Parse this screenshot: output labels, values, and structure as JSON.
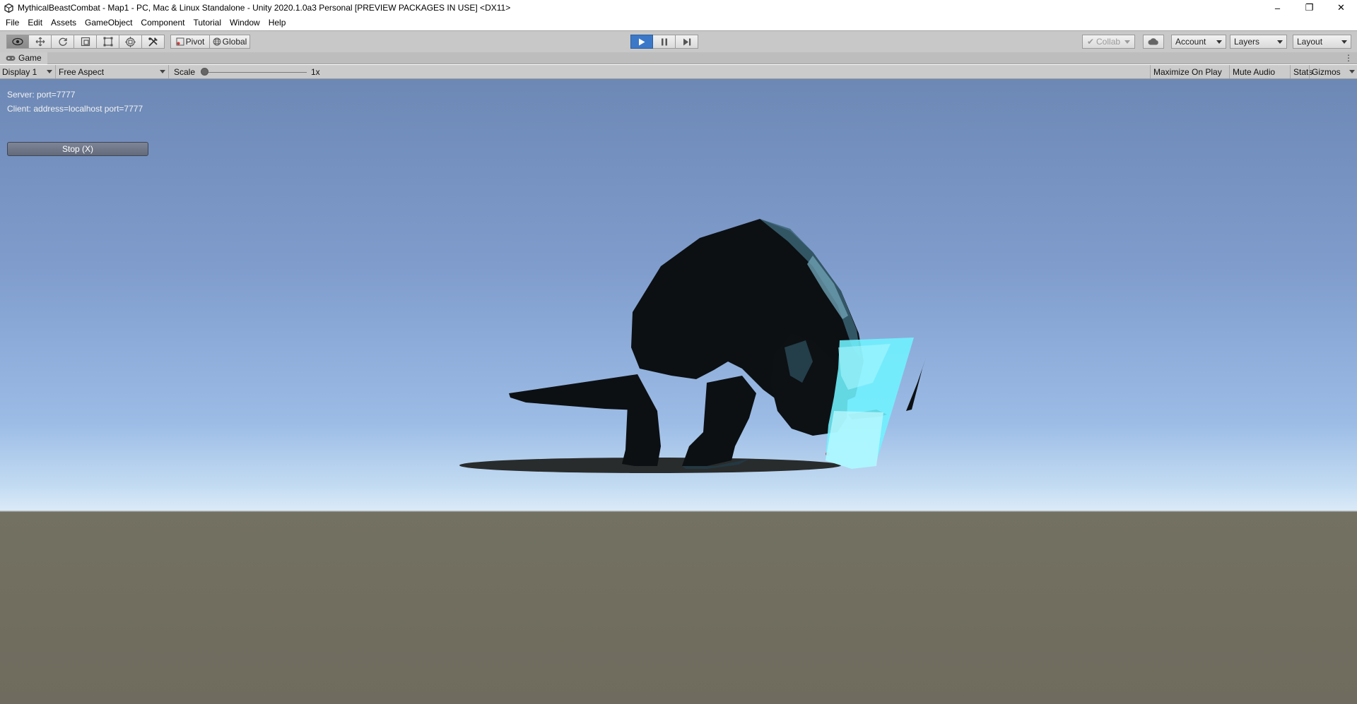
{
  "window": {
    "title": "MythicalBeastCombat - Map1 - PC, Mac & Linux Standalone - Unity 2020.1.0a3 Personal [PREVIEW PACKAGES IN USE] <DX11>",
    "icon": "unity-logo-icon",
    "controls": {
      "minimize": "–",
      "maximize": "❐",
      "close": "✕"
    }
  },
  "menu": [
    "File",
    "Edit",
    "Assets",
    "GameObject",
    "Component",
    "Tutorial",
    "Window",
    "Help"
  ],
  "toolbar": {
    "tools": [
      "view-tool-icon",
      "move-tool-icon",
      "rotate-tool-icon",
      "scale-tool-icon",
      "rect-tool-icon",
      "transform-tool-icon",
      "custom-tool-icon"
    ],
    "pivot_label": "Pivot",
    "global_label": "Global",
    "play": {
      "playing": true
    },
    "collab_label": "Collab",
    "account_label": "Account",
    "layers_label": "Layers",
    "layout_label": "Layout"
  },
  "game_view": {
    "tab_label": "Game",
    "display_label": "Display 1",
    "aspect_label": "Free Aspect",
    "scale_label": "Scale",
    "scale_value_label": "1x",
    "scale_value": 1,
    "maximize_on_play_label": "Maximize On Play",
    "mute_audio_label": "Mute Audio",
    "stats_label": "Stats",
    "gizmos_label": "Gizmos"
  },
  "hud": {
    "server_text": "Server: port=7777",
    "client_text": "Client: address=localhost port=7777",
    "stop_label": "Stop (X)"
  },
  "colors": {
    "play_active": "#3c78c8",
    "sky_top": "#6d88b5",
    "sky_horizon": "#dbeaf8",
    "ground": "#737161",
    "effect": "#6ff3ff"
  }
}
